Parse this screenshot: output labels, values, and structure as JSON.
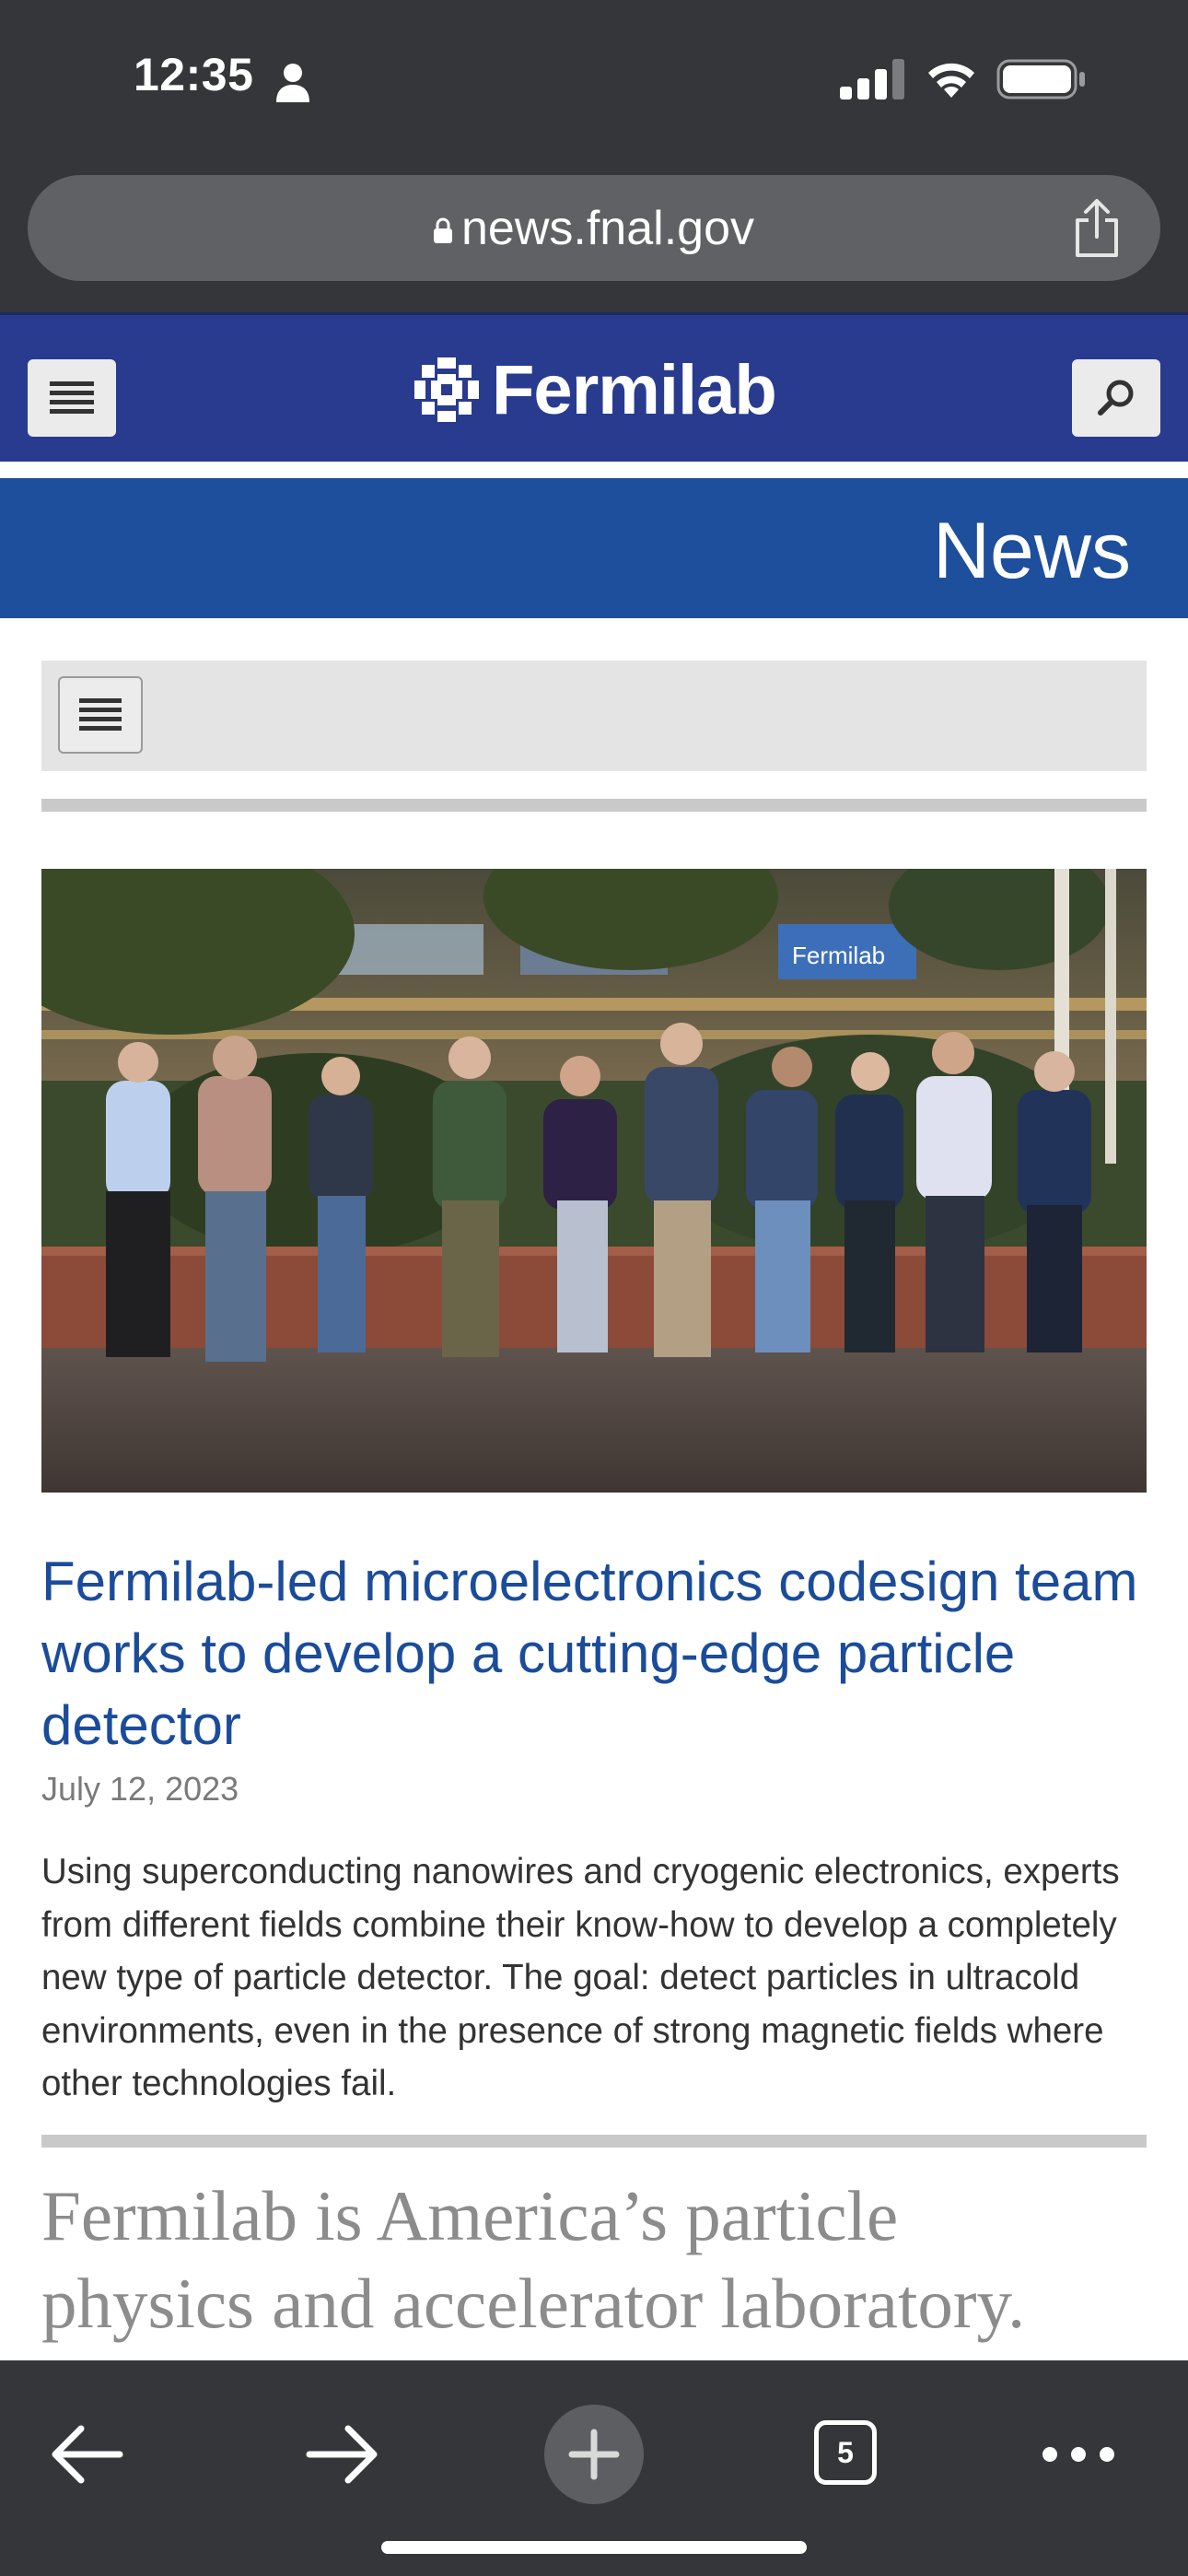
{
  "status_bar": {
    "time": "12:35",
    "icons": [
      "person-icon",
      "cellular-signal-icon",
      "wifi-icon",
      "battery-icon"
    ]
  },
  "browser": {
    "url": "news.fnal.gov",
    "share_icon": "share-icon",
    "toolbar": {
      "back_icon": "back-arrow-icon",
      "forward_icon": "forward-arrow-icon",
      "new_tab_icon": "plus-icon",
      "tab_count": "5",
      "more_icon": "more-dots-icon"
    }
  },
  "site_header": {
    "brand": "Fermilab",
    "menu_icon": "hamburger-menu-icon",
    "search_icon": "search-icon",
    "colors": {
      "header_bg": "#283b8f",
      "banner_bg": "#1d4f9c",
      "link": "#1b4c9a"
    }
  },
  "section": {
    "title": "News"
  },
  "article": {
    "title": "Fermilab-led microelectronics codesign team works to develop a cutting-edge particle detector",
    "date": "July 12, 2023",
    "summary": "Using superconducting nanowires and cryogenic electronics, experts from different fields combine their know-how to develop a completely new type of particle detector. The goal: detect particles in ultracold environments, even in the presence of strong magnetic fields where other technologies fail.",
    "photo_sign": "Fermilab"
  },
  "tagline": {
    "line1": "Fermilab is America’s particle",
    "line2": "physics and accelerator laboratory."
  }
}
